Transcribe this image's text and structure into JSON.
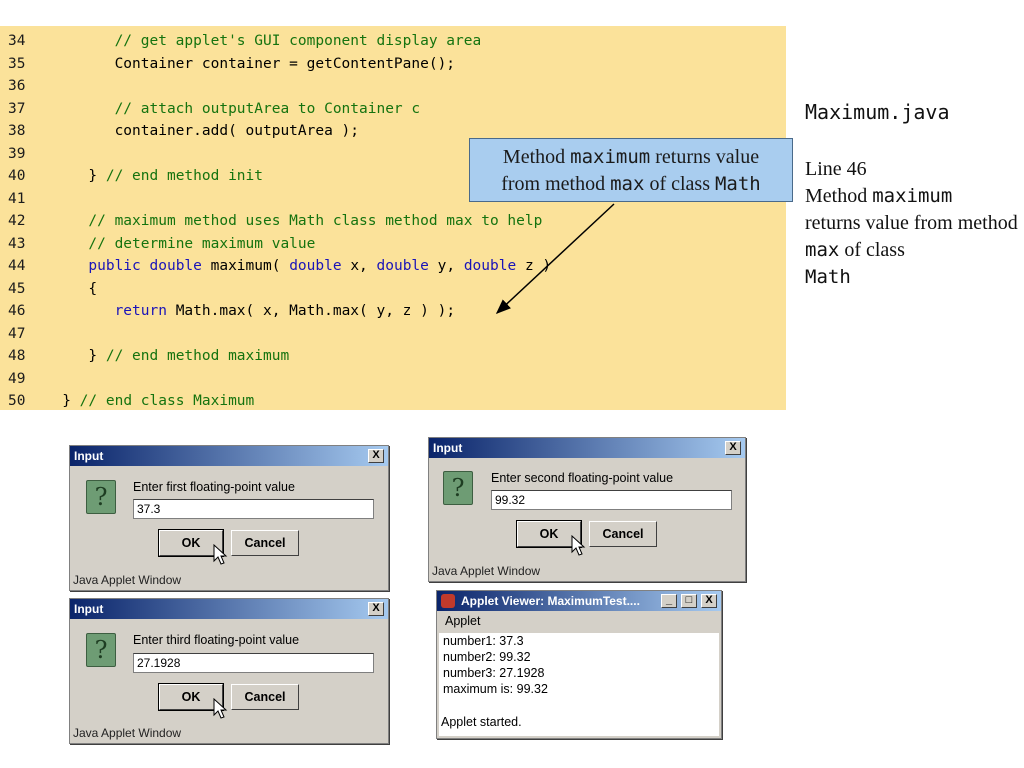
{
  "code_lines": [
    {
      "num": "34",
      "indent": "         ",
      "parts": [
        {
          "t": "cm",
          "s": "// get applet's GUI component display area"
        }
      ]
    },
    {
      "num": "35",
      "indent": "         ",
      "parts": [
        {
          "t": "tx",
          "s": "Container container = getContentPane();"
        }
      ]
    },
    {
      "num": "36",
      "indent": "",
      "parts": []
    },
    {
      "num": "37",
      "indent": "         ",
      "parts": [
        {
          "t": "cm",
          "s": "// attach outputArea to Container c"
        }
      ]
    },
    {
      "num": "38",
      "indent": "         ",
      "parts": [
        {
          "t": "tx",
          "s": "container.add( outputArea );"
        }
      ]
    },
    {
      "num": "39",
      "indent": "",
      "parts": []
    },
    {
      "num": "40",
      "indent": "      ",
      "parts": [
        {
          "t": "tx",
          "s": "} "
        },
        {
          "t": "cm",
          "s": "// end method init"
        }
      ]
    },
    {
      "num": "41",
      "indent": "",
      "parts": []
    },
    {
      "num": "42",
      "indent": "      ",
      "parts": [
        {
          "t": "cm",
          "s": "// maximum method uses Math class method max to help"
        }
      ]
    },
    {
      "num": "43",
      "indent": "      ",
      "parts": [
        {
          "t": "cm",
          "s": "// determine maximum value"
        }
      ]
    },
    {
      "num": "44",
      "indent": "      ",
      "parts": [
        {
          "t": "kw",
          "s": "public double"
        },
        {
          "t": "tx",
          "s": " maximum( "
        },
        {
          "t": "kw",
          "s": "double"
        },
        {
          "t": "tx",
          "s": " x, "
        },
        {
          "t": "kw",
          "s": "double"
        },
        {
          "t": "tx",
          "s": " y, "
        },
        {
          "t": "kw",
          "s": "double"
        },
        {
          "t": "tx",
          "s": " z )"
        }
      ]
    },
    {
      "num": "45",
      "indent": "      ",
      "parts": [
        {
          "t": "tx",
          "s": "{"
        }
      ]
    },
    {
      "num": "46",
      "indent": "         ",
      "parts": [
        {
          "t": "kw",
          "s": "return"
        },
        {
          "t": "tx",
          "s": " Math.max( x, Math.max( y, z ) );"
        }
      ]
    },
    {
      "num": "47",
      "indent": "",
      "parts": []
    },
    {
      "num": "48",
      "indent": "      ",
      "parts": [
        {
          "t": "tx",
          "s": "} "
        },
        {
          "t": "cm",
          "s": "// end method maximum"
        }
      ]
    },
    {
      "num": "49",
      "indent": "",
      "parts": []
    },
    {
      "num": "50",
      "indent": "   ",
      "parts": [
        {
          "t": "tx",
          "s": "} "
        },
        {
          "t": "cm",
          "s": "// end class Maximum"
        }
      ]
    }
  ],
  "callout": {
    "line1_a": "Method ",
    "line1_b": "maximum",
    "line1_c": " returns value",
    "line2_a": "from method ",
    "line2_b": "max",
    "line2_c": " of class ",
    "line2_d": "Math"
  },
  "side": {
    "file": "Maximum.java",
    "line_ref": "Line 46",
    "desc_a": "Method ",
    "desc_b": "maximum",
    "desc_c": "returns value from method ",
    "desc_d": "max",
    "desc_e": " of class",
    "desc_f": "Math"
  },
  "dialogs": {
    "first": {
      "title": "Input",
      "prompt": "Enter first floating-point value",
      "value": "37.3",
      "ok": "OK",
      "cancel": "Cancel",
      "footer": "Java Applet Window",
      "close": "X"
    },
    "second": {
      "title": "Input",
      "prompt": "Enter second floating-point value",
      "value": "99.32",
      "ok": "OK",
      "cancel": "Cancel",
      "footer": "Java Applet Window",
      "close": "X"
    },
    "third": {
      "title": "Input",
      "prompt": "Enter third floating-point value",
      "value": "27.1928",
      "ok": "OK",
      "cancel": "Cancel",
      "footer": "Java Applet Window",
      "close": "X"
    }
  },
  "applet": {
    "title": "Applet Viewer: MaximumTest....",
    "menu": "Applet",
    "minimize": "_",
    "maximize": "□",
    "close": "X",
    "lines": [
      "number1: 37.3",
      "number2: 99.32",
      "number3: 27.1928",
      "maximum is: 99.32"
    ],
    "status": "Applet started."
  },
  "colors": {
    "code_bg": "#fbe29a",
    "comment": "#15730f",
    "keyword": "#1a14b8",
    "callout_bg": "#a9cdef",
    "titlebar": "#0a246a"
  }
}
